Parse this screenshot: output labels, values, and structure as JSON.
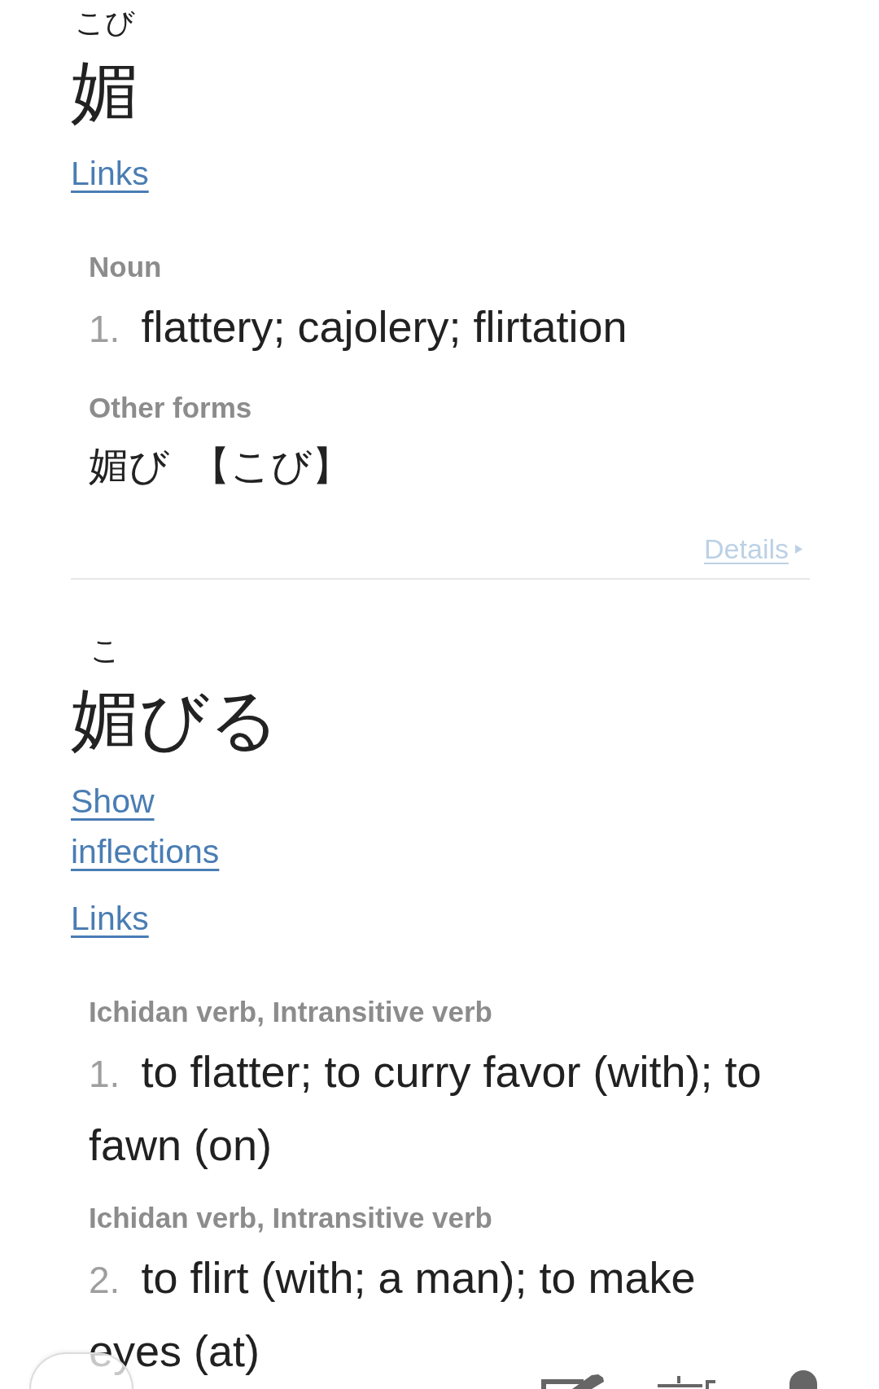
{
  "entries": [
    {
      "headword": [
        {
          "text": "媚",
          "reading": "こび"
        }
      ],
      "links": [
        {
          "label": "Links"
        }
      ],
      "senses": [
        {
          "pos": "Noun",
          "number": "1.",
          "gloss": "flattery; cajolery; flirtation"
        }
      ],
      "other_forms": {
        "heading": "Other forms",
        "forms": [
          {
            "text": "媚び",
            "reading": "【こび】"
          }
        ]
      },
      "details": {
        "label": "Details"
      }
    },
    {
      "headword": [
        {
          "text": "媚",
          "reading": "こ"
        },
        {
          "text": "びる"
        }
      ],
      "links": [
        {
          "label": "Show inflections"
        },
        {
          "label": "Links"
        }
      ],
      "senses": [
        {
          "pos": "Ichidan verb, Intransitive verb",
          "number": "1.",
          "gloss": "to flatter; to curry favor (with); to fawn (on)"
        },
        {
          "pos": "Ichidan verb, Intransitive verb",
          "number": "2.",
          "gloss": "to flirt (with; a man); to make eyes (at)"
        }
      ]
    }
  ]
}
